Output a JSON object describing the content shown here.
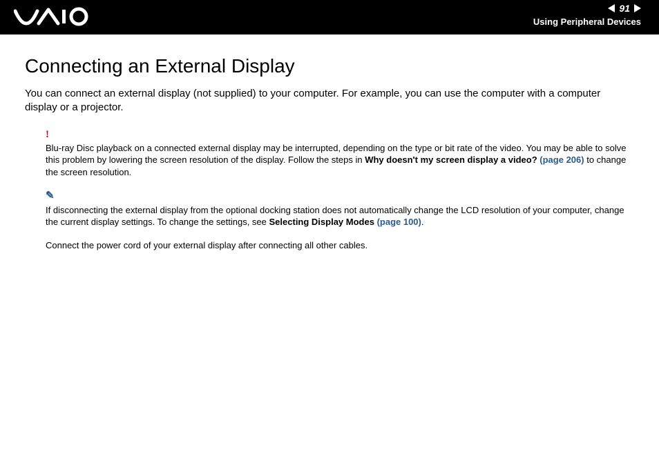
{
  "header": {
    "page_number": "91",
    "section": "Using Peripheral Devices"
  },
  "title": "Connecting an External Display",
  "intro": "You can connect an external display (not supplied) to your computer. For example, you can use the computer with a computer display or a projector.",
  "warning": {
    "text_before": "Blu-ray Disc playback on a connected external display may be interrupted, depending on the type or bit rate of the video. You may be able to solve this problem by lowering the screen resolution of the display. Follow the steps in ",
    "bold1": "Why doesn't my screen display a video?",
    "link1": " (page 206)",
    "text_after": " to change the screen resolution."
  },
  "note": {
    "text_before": "If disconnecting the external display from the optional docking station does not automatically change the LCD resolution of your computer, change the current display settings. To change the settings, see ",
    "bold1": "Selecting Display Modes",
    "link1": " (page 100)",
    "text_after": "."
  },
  "footer_line": "Connect the power cord of your external display after connecting all other cables."
}
